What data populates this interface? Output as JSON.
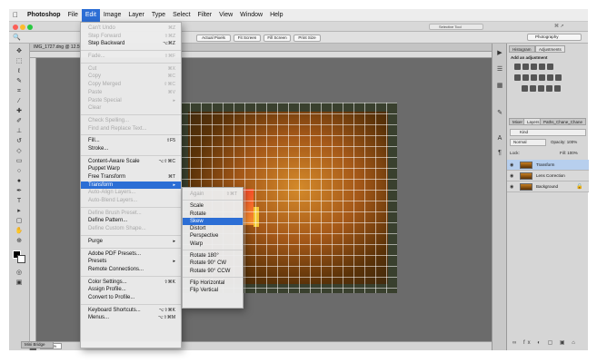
{
  "menubar": {
    "apple": "",
    "app": "Photoshop",
    "items": [
      "File",
      "Edit",
      "Image",
      "Layer",
      "Type",
      "Select",
      "Filter",
      "View",
      "Window",
      "Help"
    ]
  },
  "window": {
    "status": "Selective Tool",
    "doc_tab": "IMG_1727.dng @ 12.5%",
    "zoom": "12.85%",
    "bottom_tab": "Mini Bridge"
  },
  "options": {
    "buttons": [
      "Actual Pixels",
      "Fit Screen",
      "Fill Screen",
      "Print Size"
    ],
    "workspace": "Photography"
  },
  "panels": {
    "tabs_top": [
      "Histogram",
      "Adjustments"
    ],
    "add_adjustment": "Add an adjustment",
    "tabs_layers": [
      "Mixer",
      "Layers",
      "Paths_Chane_Chane"
    ],
    "kind": "Kind",
    "blend": "Normal",
    "opacity": "Opacity: 100%",
    "lock": "Lock:",
    "fill": "Fill: 100%",
    "layers": [
      "Transform",
      "Lens Correction",
      "Background"
    ]
  },
  "edit_menu": {
    "items": [
      {
        "label": "Can't Undo",
        "shortcut": "⌘Z",
        "disabled": true
      },
      {
        "label": "Step Forward",
        "shortcut": "⇧⌘Z",
        "disabled": true
      },
      {
        "label": "Step Backward",
        "shortcut": "⌥⌘Z",
        "disabled": false
      },
      {
        "sep": true
      },
      {
        "label": "Fade...",
        "shortcut": "⇧⌘F",
        "disabled": true
      },
      {
        "sep": true
      },
      {
        "label": "Cut",
        "shortcut": "⌘X",
        "disabled": true
      },
      {
        "label": "Copy",
        "shortcut": "⌘C",
        "disabled": true
      },
      {
        "label": "Copy Merged",
        "shortcut": "⇧⌘C",
        "disabled": true
      },
      {
        "label": "Paste",
        "shortcut": "⌘V",
        "disabled": true
      },
      {
        "label": "Paste Special",
        "shortcut": "▸",
        "disabled": true
      },
      {
        "label": "Clear",
        "shortcut": "",
        "disabled": true
      },
      {
        "sep": true
      },
      {
        "label": "Check Spelling...",
        "shortcut": "",
        "disabled": true
      },
      {
        "label": "Find and Replace Text...",
        "shortcut": "",
        "disabled": true
      },
      {
        "sep": true
      },
      {
        "label": "Fill...",
        "shortcut": "⇧F5",
        "disabled": false
      },
      {
        "label": "Stroke...",
        "shortcut": "",
        "disabled": false
      },
      {
        "sep": true
      },
      {
        "label": "Content-Aware Scale",
        "shortcut": "⌥⇧⌘C",
        "disabled": false
      },
      {
        "label": "Puppet Warp",
        "shortcut": "",
        "disabled": false
      },
      {
        "label": "Free Transform",
        "shortcut": "⌘T",
        "disabled": false
      },
      {
        "label": "Transform",
        "shortcut": "▸",
        "disabled": false,
        "highlight": true
      },
      {
        "label": "Auto-Align Layers...",
        "shortcut": "",
        "disabled": true
      },
      {
        "label": "Auto-Blend Layers...",
        "shortcut": "",
        "disabled": true
      },
      {
        "sep": true
      },
      {
        "label": "Define Brush Preset...",
        "shortcut": "",
        "disabled": true
      },
      {
        "label": "Define Pattern...",
        "shortcut": "",
        "disabled": false
      },
      {
        "label": "Define Custom Shape...",
        "shortcut": "",
        "disabled": true
      },
      {
        "sep": true
      },
      {
        "label": "Purge",
        "shortcut": "▸",
        "disabled": false
      },
      {
        "sep": true
      },
      {
        "label": "Adobe PDF Presets...",
        "shortcut": "",
        "disabled": false
      },
      {
        "label": "Presets",
        "shortcut": "▸",
        "disabled": false
      },
      {
        "label": "Remote Connections...",
        "shortcut": "",
        "disabled": false
      },
      {
        "sep": true
      },
      {
        "label": "Color Settings...",
        "shortcut": "⇧⌘K",
        "disabled": false
      },
      {
        "label": "Assign Profile...",
        "shortcut": "",
        "disabled": false
      },
      {
        "label": "Convert to Profile...",
        "shortcut": "",
        "disabled": false
      },
      {
        "sep": true
      },
      {
        "label": "Keyboard Shortcuts...",
        "shortcut": "⌥⇧⌘K",
        "disabled": false
      },
      {
        "label": "Menus...",
        "shortcut": "⌥⇧⌘M",
        "disabled": false
      }
    ]
  },
  "transform_menu": {
    "items": [
      {
        "label": "Again",
        "shortcut": "⇧⌘T",
        "disabled": true
      },
      {
        "sep": true
      },
      {
        "label": "Scale",
        "shortcut": "",
        "disabled": false
      },
      {
        "label": "Rotate",
        "shortcut": "",
        "disabled": false
      },
      {
        "label": "Skew",
        "shortcut": "",
        "disabled": false,
        "highlight": true
      },
      {
        "label": "Distort",
        "shortcut": "",
        "disabled": false
      },
      {
        "label": "Perspective",
        "shortcut": "",
        "disabled": false
      },
      {
        "label": "Warp",
        "shortcut": "",
        "disabled": false
      },
      {
        "sep": true
      },
      {
        "label": "Rotate 180°",
        "shortcut": "",
        "disabled": false
      },
      {
        "label": "Rotate 90° CW",
        "shortcut": "",
        "disabled": false
      },
      {
        "label": "Rotate 90° CCW",
        "shortcut": "",
        "disabled": false
      },
      {
        "sep": true
      },
      {
        "label": "Flip Horizontal",
        "shortcut": "",
        "disabled": false
      },
      {
        "label": "Flip Vertical",
        "shortcut": "",
        "disabled": false
      }
    ]
  }
}
